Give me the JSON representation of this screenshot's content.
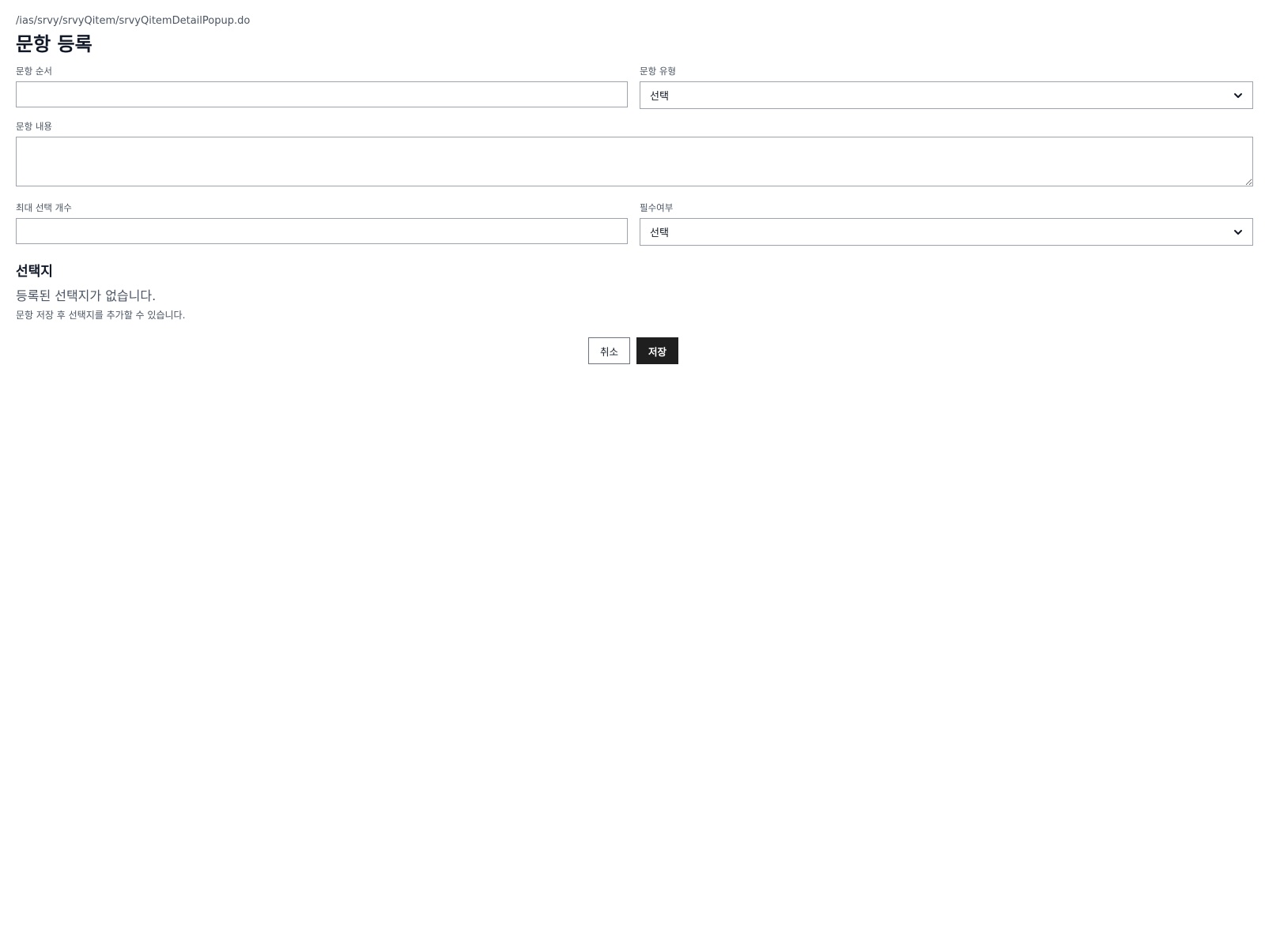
{
  "url_path": "/ias/srvy/srvyQitem/srvyQitemDetailPopup.do",
  "page_title": "문항 등록",
  "form": {
    "order": {
      "label": "문항 순서",
      "value": ""
    },
    "type": {
      "label": "문항 유형",
      "selected": "선택"
    },
    "content": {
      "label": "문항 내용",
      "value": ""
    },
    "max_select": {
      "label": "최대 선택 개수",
      "value": ""
    },
    "required": {
      "label": "필수여부",
      "selected": "선택"
    }
  },
  "options_section": {
    "title": "선택지",
    "empty_message": "등록된 선택지가 없습니다.",
    "help_text": "문항 저장 후 선택지를 추가할 수 있습니다."
  },
  "buttons": {
    "cancel_label": "취소",
    "save_label": "저장"
  },
  "icons": {
    "select_arrow": "chevron-down-icon"
  },
  "colors": {
    "primary_button": "#1f1f1f",
    "border": "#9ca3af",
    "muted_text": "#4b5563"
  }
}
